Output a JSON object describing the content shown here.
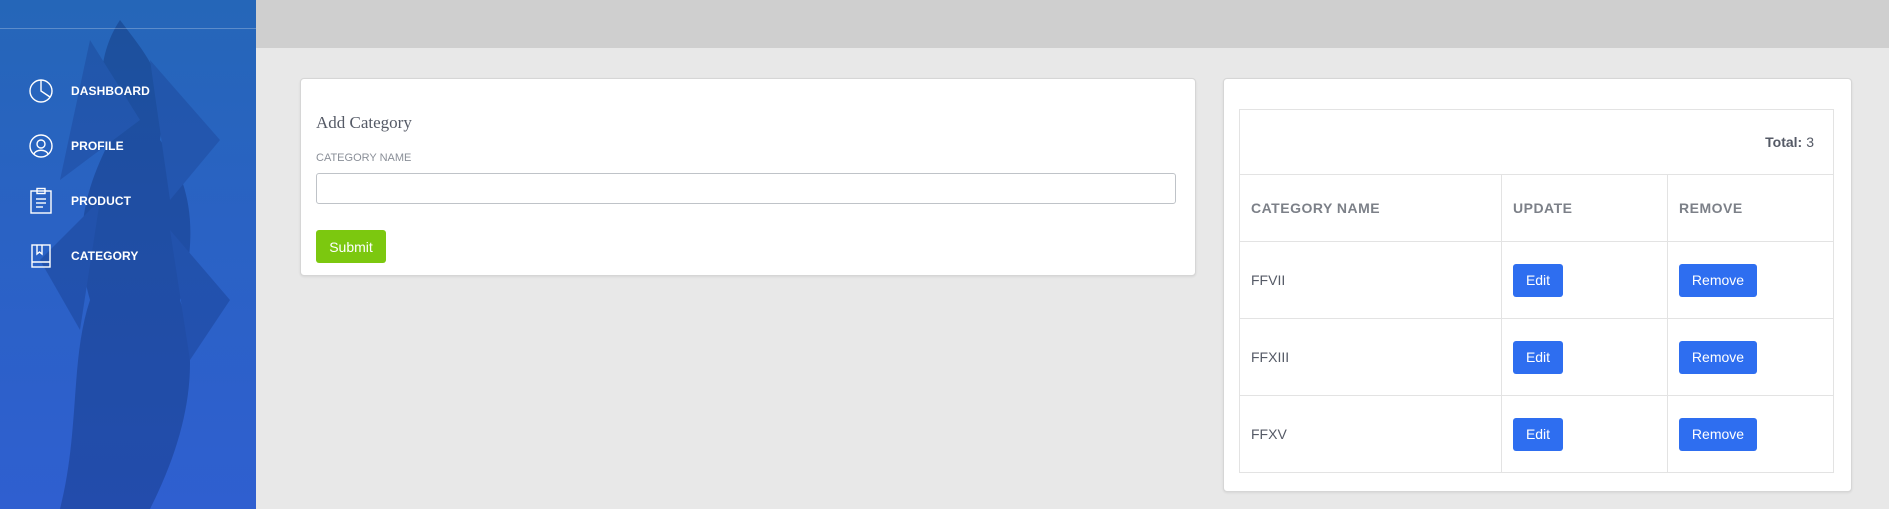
{
  "sidebar": {
    "items": [
      {
        "label": "DASHBOARD",
        "icon": "pie-chart-icon"
      },
      {
        "label": "PROFILE",
        "icon": "user-icon"
      },
      {
        "label": "PRODUCT",
        "icon": "clipboard-icon"
      },
      {
        "label": "CATEGORY",
        "icon": "book-icon"
      }
    ]
  },
  "form": {
    "title": "Add Category",
    "label": "CATEGORY NAME",
    "input_value": "",
    "submit_label": "Submit"
  },
  "table": {
    "total_label": "Total:",
    "total_value": "3",
    "headers": [
      "CATEGORY NAME",
      "UPDATE",
      "REMOVE"
    ],
    "rows": [
      {
        "name": "FFVII",
        "edit": "Edit",
        "remove": "Remove"
      },
      {
        "name": "FFXIII",
        "edit": "Edit",
        "remove": "Remove"
      },
      {
        "name": "FFXV",
        "edit": "Edit",
        "remove": "Remove"
      }
    ]
  },
  "colors": {
    "sidebar": "#2a62c4",
    "accent_green": "#7cc80f",
    "accent_blue": "#2e6ef0",
    "topbar": "#cfcfcf",
    "background": "#e8e8e8"
  }
}
